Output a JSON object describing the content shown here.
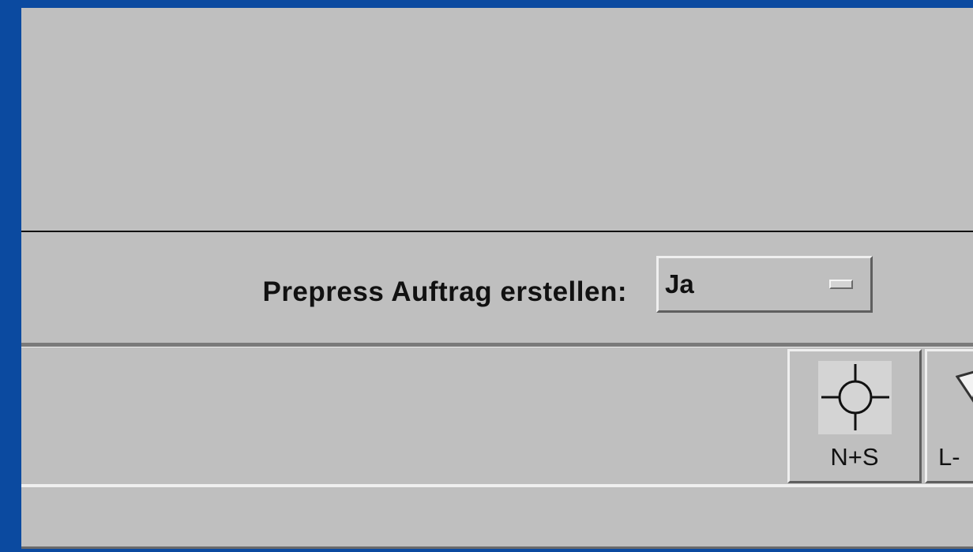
{
  "form": {
    "prepress_label": "Prepress Auftrag erstellen:",
    "prepress_value": "Ja"
  },
  "toolbar": {
    "buttons": [
      {
        "label": "N+S",
        "icon": "crosshair-icon"
      },
      {
        "label": "L-",
        "icon": "arrow-icon"
      }
    ]
  },
  "colors": {
    "desktop": "#0b4aa0",
    "panel": "#bfbfbf"
  }
}
